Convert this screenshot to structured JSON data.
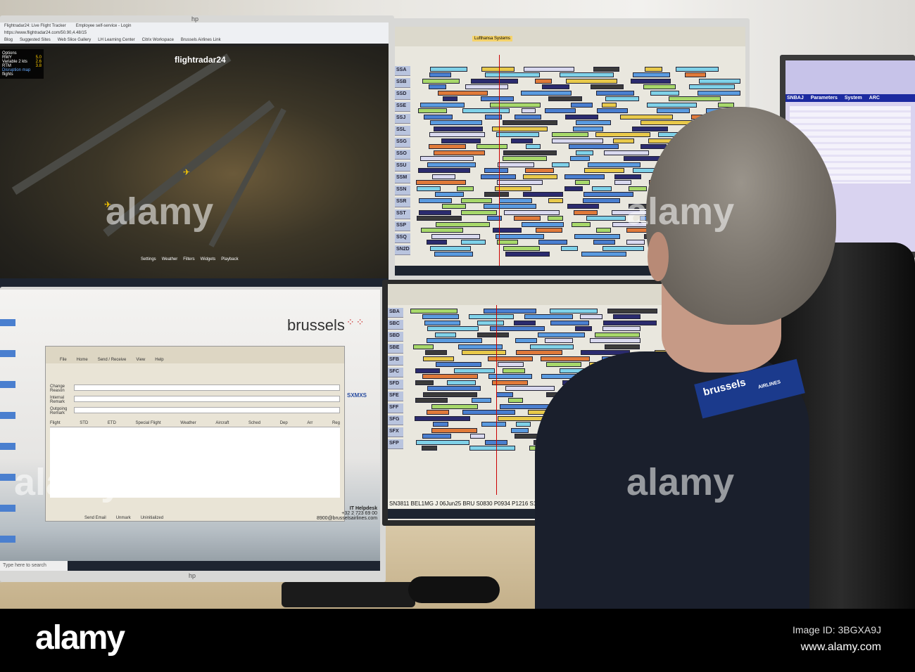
{
  "top_left_monitor": {
    "tabs": [
      "Flightradar24: Live Flight Tracker",
      "Employee self-service - Login"
    ],
    "url": "https://www.flightradar24.com/50.90,4.48/15",
    "bookmarks": [
      "Blog",
      "Suggested Sites",
      "Web Slice Gallery",
      "LH Learning Center",
      "Citrix Workspace",
      "Brussels Airlines Link"
    ],
    "logo": "flightradar24",
    "panel": {
      "title": "Options",
      "rows": [
        {
          "label": "RWY",
          "value": "5.0"
        },
        {
          "label": "Variable 2 kts",
          "value": "2.6"
        },
        {
          "label": "RTM",
          "value": "3.8"
        }
      ],
      "link": "Disruption map",
      "section": "flights"
    },
    "map_menu": [
      "Settings",
      "Weather",
      "Filters",
      "Widgets",
      "Playback"
    ]
  },
  "top_right_monitor": {
    "toolbar_button": "Lufthansa Systems",
    "rows": [
      "SSA",
      "SSB",
      "SSD",
      "SSE",
      "SSJ",
      "SSL",
      "SSG",
      "SSO",
      "SSU",
      "SSM",
      "SSN",
      "SSR",
      "SST",
      "SSP",
      "SSQ",
      "SN2D"
    ]
  },
  "bottom_left_monitor": {
    "brand": "brussels",
    "dialog": {
      "menu": [
        "File",
        "Home",
        "Send / Receive",
        "View",
        "Help"
      ],
      "fields": [
        "Change Reason",
        "Internal Remark",
        "Outgoing Remark"
      ],
      "columns": [
        "Flight",
        "STD",
        "ETD",
        "Special Flight",
        "Weather",
        "Aircraft",
        "Sched",
        "Dep",
        "Arr",
        "Reg"
      ],
      "footer": [
        "Send Email",
        "Unmark",
        "Uninitialized"
      ]
    },
    "code": "SXMXS",
    "helpdesk": {
      "title": "IT Helpdesk",
      "phone": "+32 2 723 69 00",
      "email": "8900@brusselsairlines.com"
    },
    "search_placeholder": "Type here to search"
  },
  "bottom_right_monitor": {
    "rows": [
      "SBA",
      "SBC",
      "SBD",
      "SBE",
      "SFB",
      "SFC",
      "SFD",
      "SFE",
      "SFF",
      "SFG",
      "SFX",
      "SFP"
    ],
    "status_line": "SN3811 BEL1MG J 06Jun25 BRU S0830 P0934   P1216 S1105 OPO OOTCV *SKD B"
  },
  "right_monitor": {
    "menu": [
      "SNBAJ",
      "Parameters",
      "System",
      "ARC"
    ]
  },
  "lanyard": {
    "brand": "brussels",
    "sub": "AIRLINES"
  },
  "monitor_brand": "hp",
  "watermark": {
    "logo": "alamy",
    "image_id": "Image ID: 3BGXA9J",
    "url": "www.alamy.com"
  },
  "colors": {
    "brand_blue": "#1b3a8c",
    "gantt_bg": "#e9e7de"
  }
}
